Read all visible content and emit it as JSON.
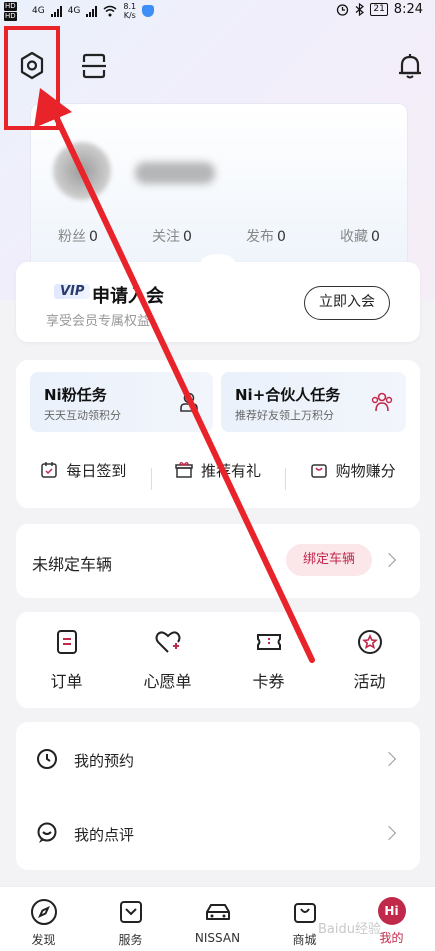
{
  "status_bar": {
    "hd1": "HD",
    "hd2": "HD",
    "net1": "4G",
    "net2": "4G",
    "speed": "8.1",
    "speed_unit": "K/s",
    "battery": "21",
    "time": "8:24"
  },
  "profile": {
    "stats": [
      {
        "label": "粉丝",
        "value": "0"
      },
      {
        "label": "关注",
        "value": "0"
      },
      {
        "label": "发布",
        "value": "0"
      },
      {
        "label": "收藏",
        "value": "0"
      }
    ]
  },
  "vip": {
    "badge": "VIP",
    "title": "申请入会",
    "subtitle": "享受会员专属权益",
    "button": "立即入会"
  },
  "tasks": [
    {
      "title": "Ni粉任务",
      "subtitle": "天天互动领积分"
    },
    {
      "title": "Ni+合伙人任务",
      "subtitle": "推荐好友领上万积分"
    }
  ],
  "quick_actions": [
    "每日签到",
    "推荐有礼",
    "购物赚分"
  ],
  "vehicle": {
    "label": "未绑定车辆",
    "button": "绑定车辆"
  },
  "shortcuts": [
    "订单",
    "心愿单",
    "卡券",
    "活动"
  ],
  "list": [
    "我的预约",
    "我的点评"
  ],
  "bottom_nav": [
    {
      "label": "发现"
    },
    {
      "label": "服务"
    },
    {
      "label": "NISSAN"
    },
    {
      "label": "商城"
    },
    {
      "label": "我的"
    }
  ],
  "me_icon_text": "Hi",
  "watermark": "Baidu经验",
  "accent_color": "#c0294a",
  "annotation_color": "#e8232a"
}
